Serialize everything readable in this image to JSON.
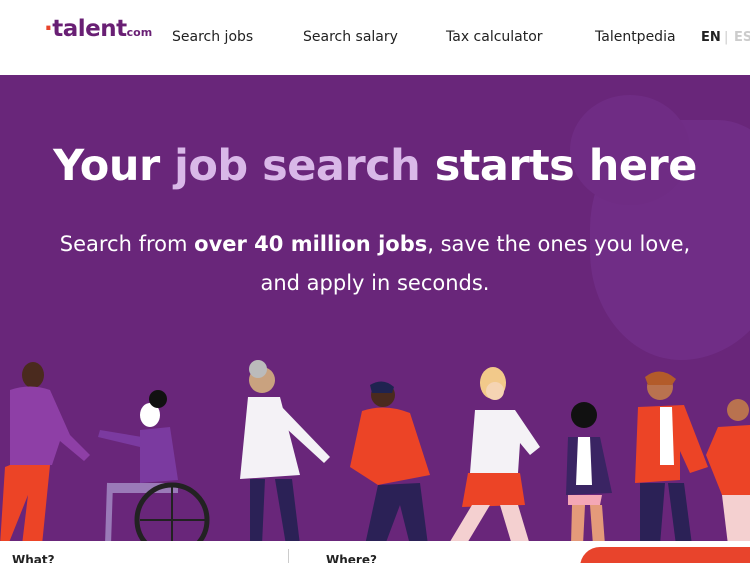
{
  "header": {
    "logo": {
      "dot": "·",
      "main": "talent",
      "suffix": "com"
    },
    "nav": [
      {
        "label": "Search jobs"
      },
      {
        "label": "Search salary"
      },
      {
        "label": "Tax calculator"
      },
      {
        "label": "Talentpedia"
      }
    ],
    "languages": {
      "active": "EN",
      "separator": "|",
      "other": "ES"
    }
  },
  "hero": {
    "headline": {
      "part1": "Your ",
      "highlight": "job search",
      "part2": " starts here"
    },
    "subtext": {
      "part1": "Search from ",
      "bold": "over 40 million jobs",
      "part2": ", save the ones you love,",
      "line2": "and apply in seconds."
    }
  },
  "search": {
    "what_label": "What?",
    "where_label": "Where?"
  },
  "colors": {
    "brand_purple": "#691f74",
    "hero_background": "#69267a",
    "highlight": "#d9b8e8",
    "accent_red": "#e8442c"
  }
}
